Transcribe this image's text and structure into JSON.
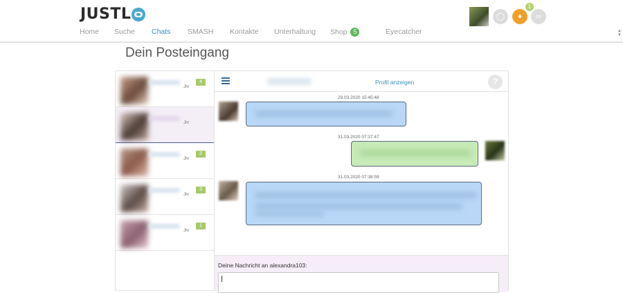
{
  "brand": {
    "logo_text": "JUSTL"
  },
  "nav": {
    "items": [
      {
        "label": "Home"
      },
      {
        "label": "Suche"
      },
      {
        "label": "Chats"
      },
      {
        "label": "SMASH"
      },
      {
        "label": "Kontakte"
      },
      {
        "label": "Unterhaltung"
      },
      {
        "label": "Shop"
      },
      {
        "label": "Eyecatcher"
      }
    ],
    "active": "Chats",
    "shop_badge": "5"
  },
  "header": {
    "notification_count": "1"
  },
  "page": {
    "title": "Dein Posteingang"
  },
  "chat_list": {
    "items": [
      {
        "age": "Jhr",
        "unread": "4"
      },
      {
        "age": "Jhr",
        "unread": ""
      },
      {
        "age": "Jhr",
        "unread": "2"
      },
      {
        "age": "Jhr",
        "unread": "3"
      },
      {
        "age": "Jhr",
        "unread": "1"
      }
    ]
  },
  "conversation": {
    "profile_link": "Profil anzeigen",
    "help": "?",
    "messages": [
      {
        "timestamp": "29.03.2020 15:45:48",
        "side": "left"
      },
      {
        "timestamp": "31.03.2020 07:37:47",
        "side": "right"
      },
      {
        "timestamp": "31.03.2020 07:38:59",
        "side": "left"
      }
    ],
    "compose_label": "Deine Nachricht an alexandra103:"
  },
  "colors": {
    "accent": "#3a8fbf",
    "incoming_bubble": "#b9d8f7",
    "outgoing_bubble": "#c7eab7",
    "badge_green": "#a8c96a",
    "notification": "#f0a02a"
  }
}
